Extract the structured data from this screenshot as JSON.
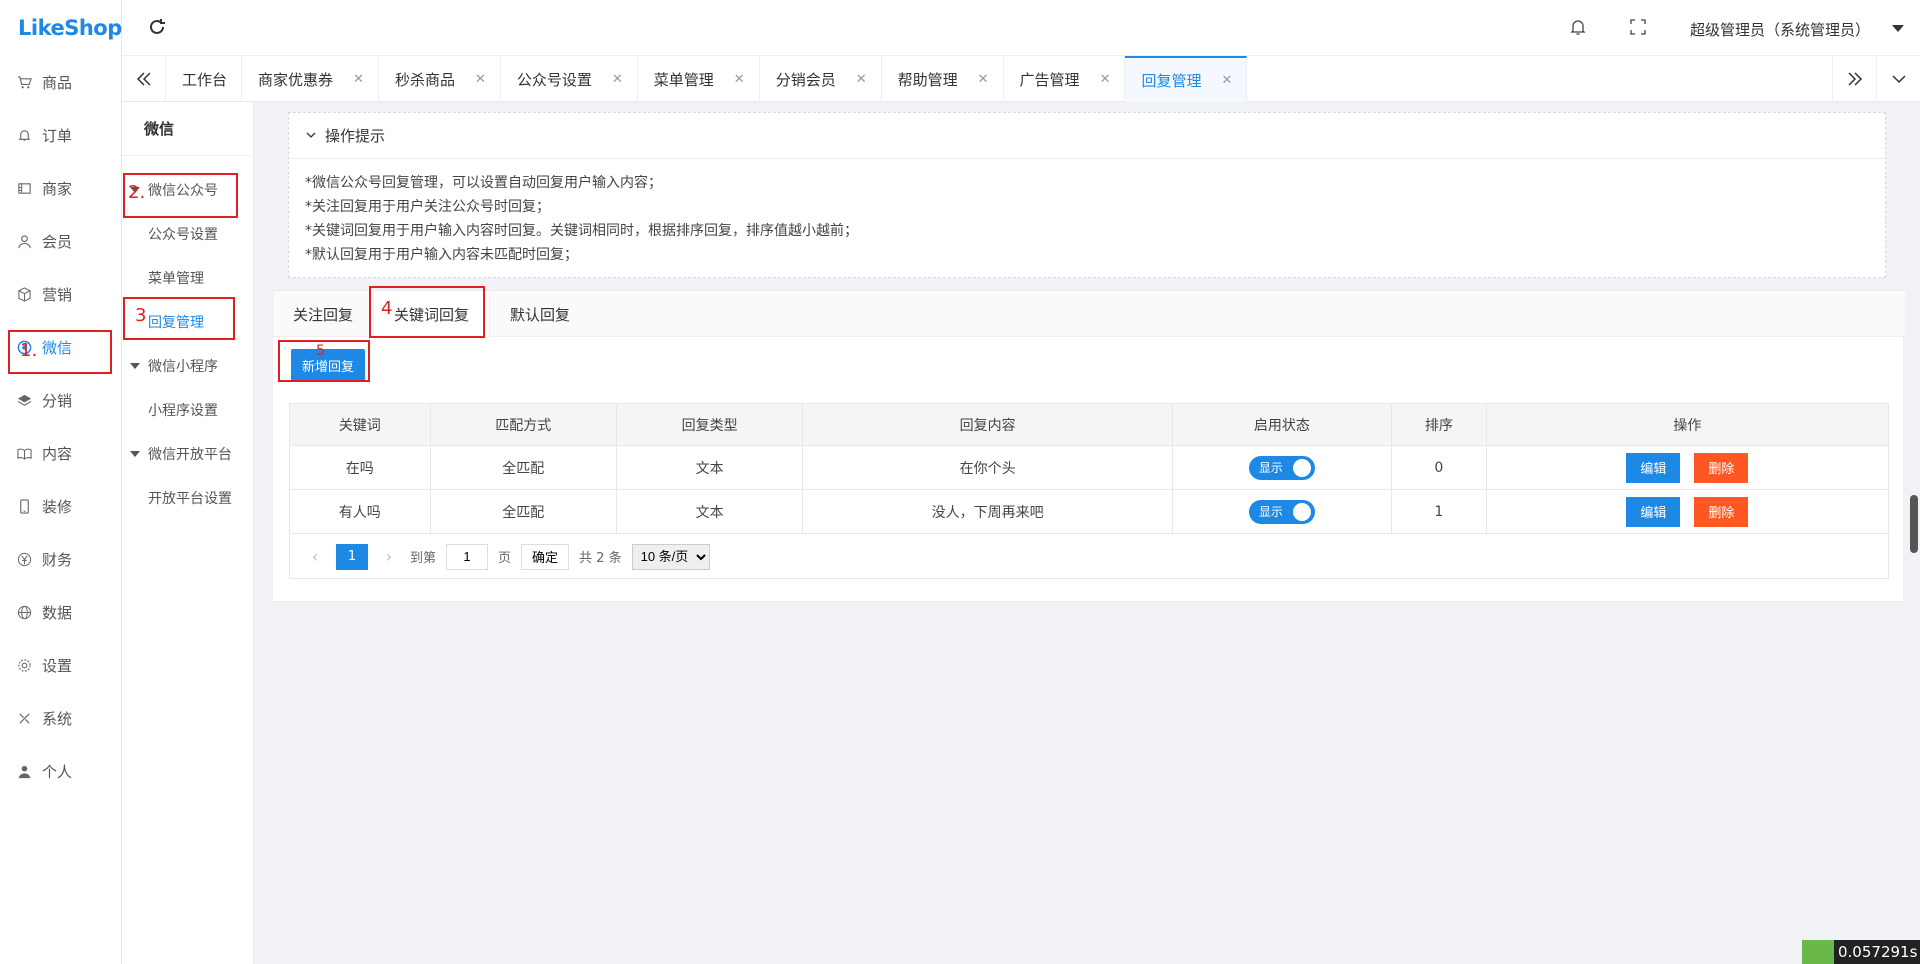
{
  "app": {
    "logo": "LikeShop"
  },
  "sidebar": {
    "items": [
      {
        "label": "商品",
        "icon": "cart-icon"
      },
      {
        "label": "订单",
        "icon": "bell-icon"
      },
      {
        "label": "商家",
        "icon": "store-icon"
      },
      {
        "label": "会员",
        "icon": "user-icon"
      },
      {
        "label": "营销",
        "icon": "box-icon"
      },
      {
        "label": "微信",
        "icon": "wechat-icon",
        "active": true
      },
      {
        "label": "分销",
        "icon": "layers-icon"
      },
      {
        "label": "内容",
        "icon": "book-icon"
      },
      {
        "label": "装修",
        "icon": "phone-icon"
      },
      {
        "label": "财务",
        "icon": "yen-icon"
      },
      {
        "label": "数据",
        "icon": "globe-icon"
      },
      {
        "label": "设置",
        "icon": "gear-icon"
      },
      {
        "label": "系统",
        "icon": "tools-icon"
      },
      {
        "label": "个人",
        "icon": "person-icon"
      }
    ]
  },
  "submenu": {
    "title": "微信",
    "group1": "微信公众号",
    "item1": "公众号设置",
    "item2": "菜单管理",
    "item3": "回复管理",
    "group2": "微信小程序",
    "item4": "小程序设置",
    "group3": "微信开放平台",
    "item5": "开放平台设置"
  },
  "header": {
    "user": "超级管理员（系统管理员）"
  },
  "tabs": [
    {
      "label": "工作台",
      "closable": false
    },
    {
      "label": "商家优惠券",
      "closable": true
    },
    {
      "label": "秒杀商品",
      "closable": true
    },
    {
      "label": "公众号设置",
      "closable": true
    },
    {
      "label": "菜单管理",
      "closable": true
    },
    {
      "label": "分销会员",
      "closable": true
    },
    {
      "label": "帮助管理",
      "closable": true
    },
    {
      "label": "广告管理",
      "closable": true
    },
    {
      "label": "回复管理",
      "closable": true,
      "active": true
    }
  ],
  "tips": {
    "title": "操作提示",
    "lines": [
      "*微信公众号回复管理，可以设置自动回复用户输入内容；",
      "*关注回复用于用户关注公众号时回复；",
      "*关键词回复用于用户输入内容时回复。关键词相同时，根据排序回复，排序值越小越前；",
      "*默认回复用于用户输入内容未匹配时回复；"
    ]
  },
  "reply_tabs": [
    "关注回复",
    "关键词回复",
    "默认回复"
  ],
  "add_button": "新增回复",
  "table": {
    "headers": [
      "关键词",
      "匹配方式",
      "回复类型",
      "回复内容",
      "启用状态",
      "排序",
      "操作"
    ],
    "rows": [
      {
        "keyword": "在吗",
        "match": "全匹配",
        "type": "文本",
        "content": "在你个头",
        "status": "显示",
        "sort": "0"
      },
      {
        "keyword": "有人吗",
        "match": "全匹配",
        "type": "文本",
        "content": "没人，下周再来吧",
        "status": "显示",
        "sort": "1"
      }
    ],
    "edit_label": "编辑",
    "delete_label": "删除"
  },
  "pager": {
    "current": "1",
    "goto_label": "到第",
    "goto_value": "1",
    "page_label": "页",
    "ok_label": "确定",
    "total": "共 2 条",
    "size": "10 条/页"
  },
  "annotations": [
    "1.",
    "2.",
    "3",
    "4",
    "5"
  ],
  "timer": "0.057291s",
  "colors": {
    "accent": "#1e88e5",
    "danger": "#ff5722",
    "annotation": "#e02020"
  }
}
